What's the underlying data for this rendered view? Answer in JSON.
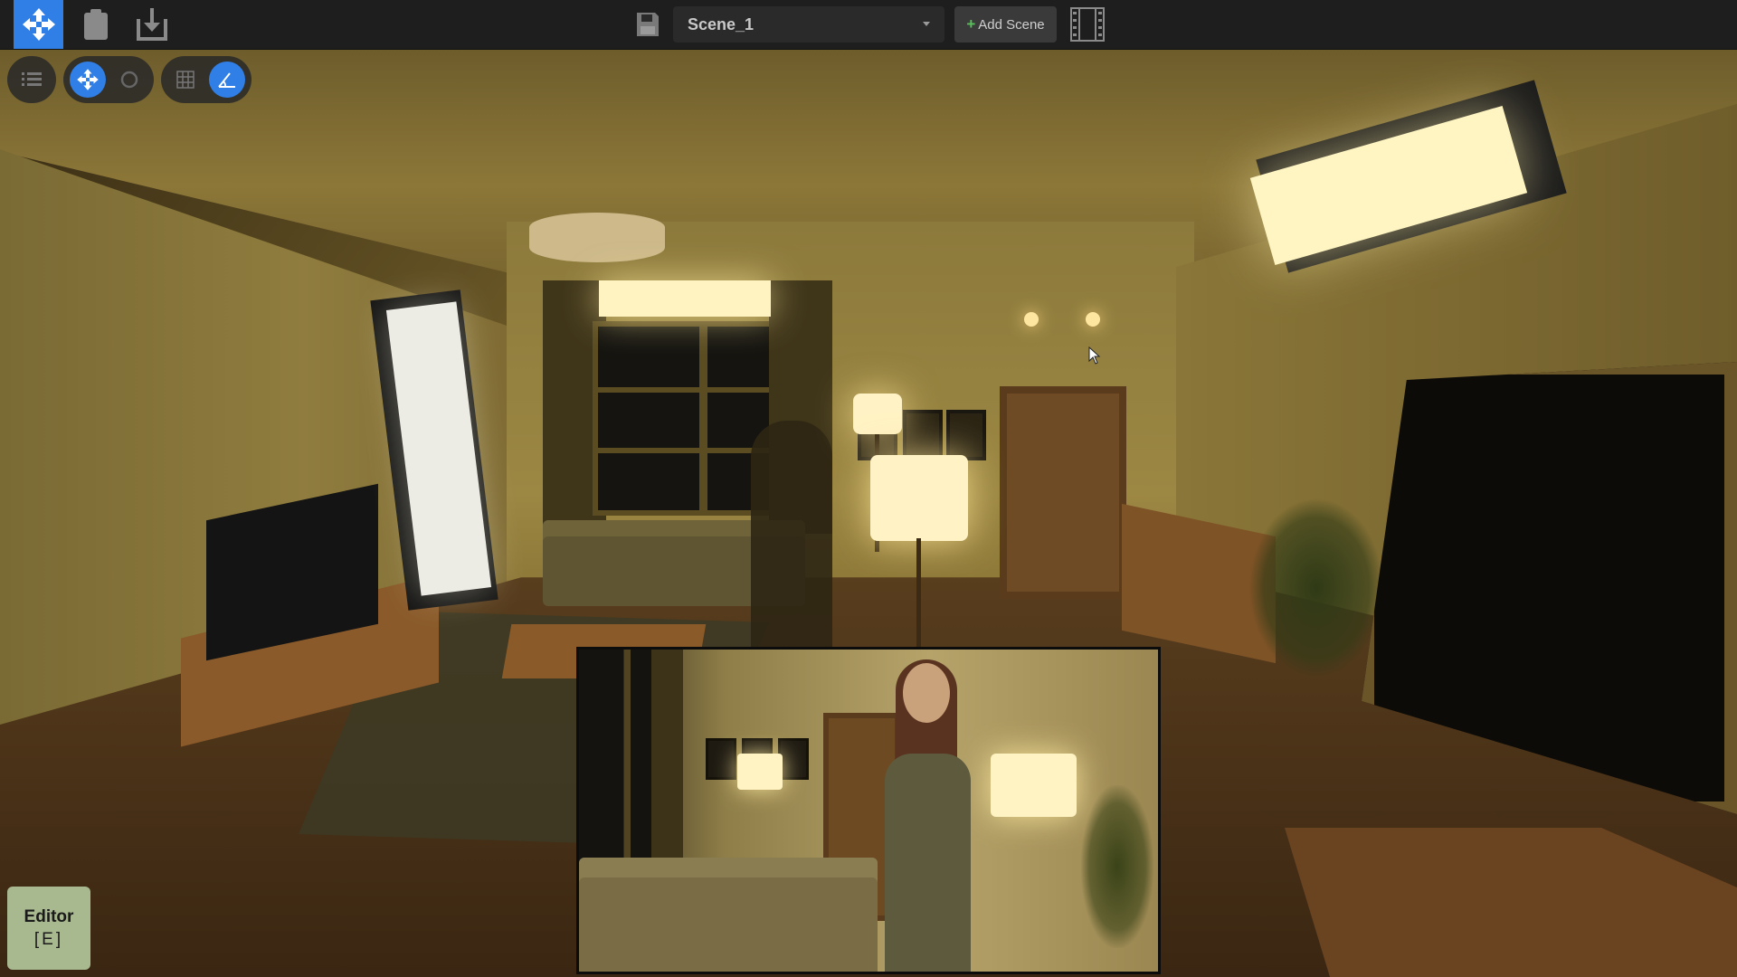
{
  "topbar": {
    "tools": [
      {
        "name": "move-tool",
        "icon": "four-way-arrow-icon",
        "active": true
      },
      {
        "name": "clipboard",
        "icon": "clipboard-icon",
        "active": false
      },
      {
        "name": "import",
        "icon": "import-icon",
        "active": false
      }
    ],
    "save_icon": "save-icon",
    "scene_selector": {
      "value": "Scene_1"
    },
    "add_scene_label": "Add Scene",
    "timeline_icon": "film-strip-icon"
  },
  "viewport_toolbar": {
    "buttons": [
      {
        "name": "outliner-button",
        "icon": "list-icon",
        "active": false
      },
      {
        "name": "translate-gizmo-button",
        "icon": "move-icon",
        "active": true
      },
      {
        "name": "rotate-gizmo-button",
        "icon": "rotate-icon",
        "active": false
      },
      {
        "name": "grid-snap-button",
        "icon": "grid-icon",
        "active": false
      },
      {
        "name": "angle-snap-button",
        "icon": "angle-icon",
        "active": true
      }
    ]
  },
  "editor_badge": {
    "label": "Editor",
    "shortcut": "[E]"
  },
  "colors": {
    "accent": "#2f7fe6",
    "add_plus": "#58c05a",
    "badge": "#a9b98f"
  }
}
